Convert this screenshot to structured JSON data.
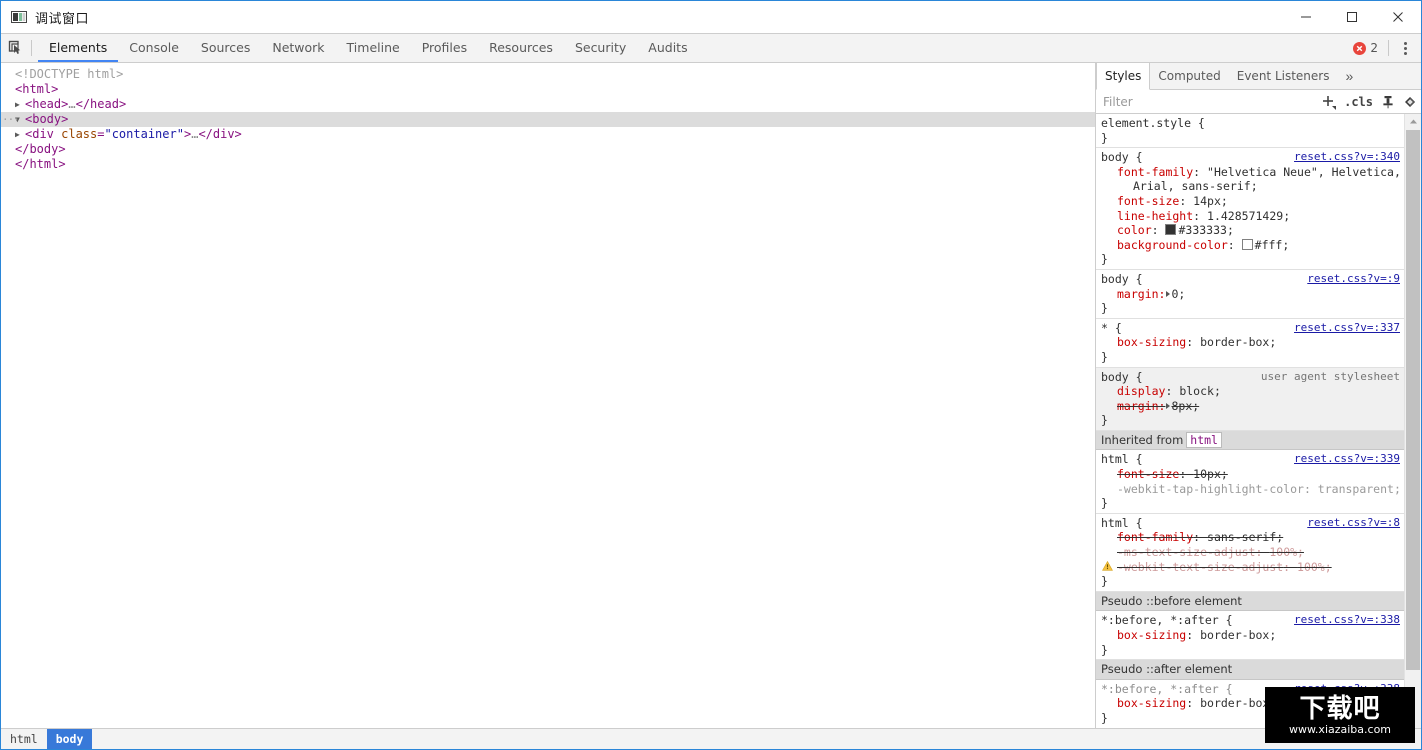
{
  "window": {
    "title": "调试窗口",
    "icon": "app-icon",
    "controls": {
      "minimize": "–",
      "maximize": "□",
      "close": "✕"
    }
  },
  "toolbar": {
    "inspect_icon": "inspect-element-icon",
    "tabs": [
      {
        "label": "Elements",
        "active": true
      },
      {
        "label": "Console",
        "active": false
      },
      {
        "label": "Sources",
        "active": false
      },
      {
        "label": "Network",
        "active": false
      },
      {
        "label": "Timeline",
        "active": false
      },
      {
        "label": "Profiles",
        "active": false
      },
      {
        "label": "Resources",
        "active": false
      },
      {
        "label": "Security",
        "active": false
      },
      {
        "label": "Audits",
        "active": false
      }
    ],
    "error_count": "2",
    "error_color": "#e8453c",
    "menu_icon": "kebab-menu-icon"
  },
  "dom": {
    "rows": [
      {
        "indent": 0,
        "twisty": "",
        "selected": false,
        "parts": [
          {
            "t": "doctype",
            "s": "<!DOCTYPE html>"
          }
        ]
      },
      {
        "indent": 0,
        "twisty": "",
        "selected": false,
        "parts": [
          {
            "t": "tag",
            "s": "<html>"
          }
        ]
      },
      {
        "indent": 0,
        "twisty": "collapsed",
        "selected": false,
        "parts": [
          {
            "t": "tag",
            "s": "<head>"
          },
          {
            "t": "ell",
            "s": "…"
          },
          {
            "t": "tag",
            "s": "</head>"
          }
        ]
      },
      {
        "indent": 0,
        "twisty": "expanded",
        "selected": true,
        "parts": [
          {
            "t": "tag",
            "s": "<body>"
          }
        ]
      },
      {
        "indent": 1,
        "twisty": "collapsed",
        "selected": false,
        "parts": [
          {
            "t": "tag",
            "s": "<div "
          },
          {
            "t": "attr",
            "s": "class"
          },
          {
            "t": "tag",
            "s": "="
          },
          {
            "t": "val",
            "s": "\"container\""
          },
          {
            "t": "tag",
            "s": ">"
          },
          {
            "t": "ell",
            "s": "…"
          },
          {
            "t": "tag",
            "s": "</div>"
          }
        ]
      },
      {
        "indent": 1,
        "twisty": "",
        "selected": false,
        "parts": [
          {
            "t": "tag",
            "s": "</body>"
          }
        ]
      },
      {
        "indent": 0,
        "twisty": "",
        "selected": false,
        "parts": [
          {
            "t": "tag",
            "s": "</html>"
          }
        ]
      }
    ]
  },
  "styles": {
    "tabs": [
      {
        "label": "Styles",
        "active": true
      },
      {
        "label": "Computed",
        "active": false
      },
      {
        "label": "Event Listeners",
        "active": false
      }
    ],
    "overflow_icon": "chevron-double-right-icon",
    "filter": {
      "placeholder": "Filter",
      "value": ""
    },
    "actions": {
      "new_rule": "+",
      "cls": ".cls",
      "pin": "pin-icon",
      "render_state": "render-state-icon"
    },
    "rules": [
      {
        "selector": "element.style {",
        "origin": "",
        "origin_link": false,
        "ua": false,
        "props": []
      },
      {
        "selector": "body {",
        "origin": "reset.css?v=:340",
        "origin_link": true,
        "ua": false,
        "props": [
          {
            "key": "font-family",
            "value": "\"Helvetica Neue\", Helvetica,",
            "cont": "Arial, sans-serif;",
            "state": ""
          },
          {
            "key": "font-size",
            "value": "14px;",
            "state": ""
          },
          {
            "key": "line-height",
            "value": "1.428571429;",
            "state": ""
          },
          {
            "key": "color",
            "value": "#333333;",
            "swatch": "#333333",
            "state": ""
          },
          {
            "key": "background-color",
            "value": "#fff;",
            "swatch": "#ffffff",
            "state": ""
          }
        ]
      },
      {
        "selector": "body {",
        "origin": "reset.css?v=:9",
        "origin_link": true,
        "ua": false,
        "props": [
          {
            "key": "margin:",
            "value": "0;",
            "arrow": true,
            "state": ""
          }
        ]
      },
      {
        "selector": "* {",
        "origin": "reset.css?v=:337",
        "origin_link": true,
        "ua": false,
        "props": [
          {
            "key": "box-sizing",
            "value": "border-box;",
            "state": ""
          }
        ]
      },
      {
        "selector": "body {",
        "origin": "user agent stylesheet",
        "origin_link": false,
        "ua": true,
        "props": [
          {
            "key": "display",
            "value": "block;",
            "state": ""
          },
          {
            "key": "margin:",
            "value": "8px;",
            "arrow": true,
            "state": "strike"
          }
        ]
      }
    ],
    "inherited_header": {
      "text": "Inherited from",
      "tag": "html"
    },
    "inherited_rules": [
      {
        "selector": "html {",
        "origin": "reset.css?v=:339",
        "origin_link": true,
        "props": [
          {
            "key": "font-size",
            "value": "10px;",
            "state": "strike"
          },
          {
            "key": "-webkit-tap-highlight-color",
            "value": "transparent;",
            "state": "off"
          }
        ]
      },
      {
        "selector": "html {",
        "origin": "reset.css?v=:8",
        "origin_link": true,
        "props": [
          {
            "key": "font-family",
            "value": "sans-serif;",
            "state": "strike"
          },
          {
            "key": "-ms-text-size-adjust",
            "value": "100%;",
            "state": "strike off"
          },
          {
            "key": "-webkit-text-size-adjust",
            "value": "100%;",
            "state": "strike off",
            "warn": true
          }
        ]
      }
    ],
    "pseudo_sections": [
      {
        "header": "Pseudo ::before element",
        "selector": "*:before, *:after {",
        "origin": "reset.css?v=:338",
        "muted": false,
        "props": [
          {
            "key": "box-sizing",
            "value": "border-box;",
            "state": ""
          }
        ]
      },
      {
        "header": "Pseudo ::after element",
        "selector": "*:before, *:after {",
        "origin": "reset.css?v=:338",
        "muted": true,
        "props": [
          {
            "key": "box-sizing",
            "value": "border-box;",
            "state": ""
          }
        ]
      }
    ],
    "scrollbar": {
      "up": "scroll-up-arrow",
      "down": "scroll-down-arrow"
    }
  },
  "breadcrumb": {
    "items": [
      {
        "label": "html",
        "active": false
      },
      {
        "label": "body",
        "active": true
      }
    ]
  },
  "watermark": {
    "text": "下载吧",
    "url": "www.xiazaiba.com"
  }
}
